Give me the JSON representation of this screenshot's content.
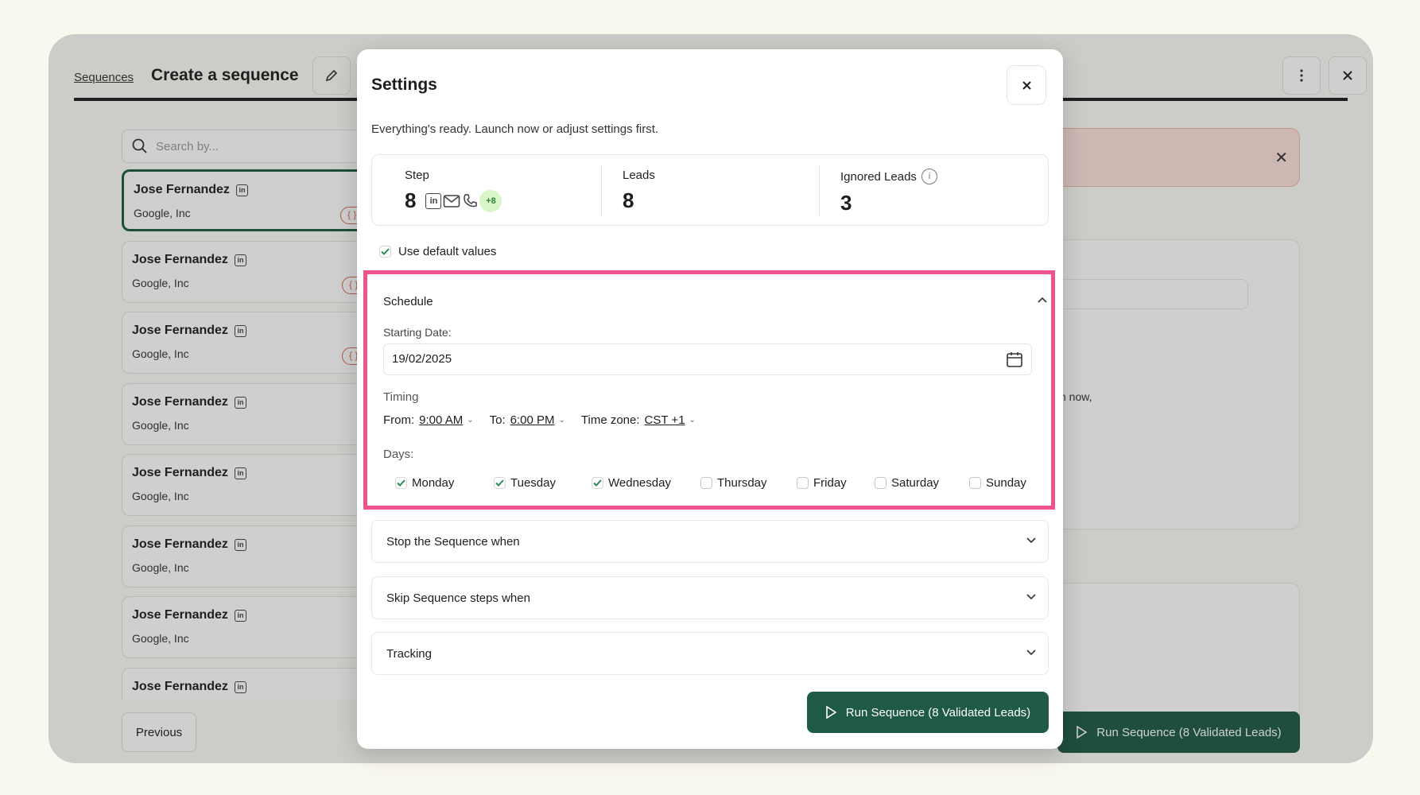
{
  "header": {
    "breadcrumb": "Sequences",
    "title": "Create a sequence"
  },
  "search": {
    "placeholder": "Search by..."
  },
  "leads": [
    {
      "name": "Jose Fernandez",
      "company": "Google, Inc",
      "tag": "{ }"
    },
    {
      "name": "Jose Fernandez",
      "company": "Google, Inc",
      "tag": "{ }"
    },
    {
      "name": "Jose Fernandez",
      "company": "Google, Inc",
      "tag": "{ }"
    },
    {
      "name": "Jose Fernandez",
      "company": "Google, Inc"
    },
    {
      "name": "Jose Fernandez",
      "company": "Google, Inc"
    },
    {
      "name": "Jose Fernandez",
      "company": "Google, Inc"
    },
    {
      "name": "Jose Fernandez",
      "company": "Google, Inc"
    },
    {
      "name": "Jose Fernandez"
    }
  ],
  "previous_label": "Previous",
  "background": {
    "partial_text": "n now,",
    "run_label": "Run Sequence (8 Validated Leads)"
  },
  "modal": {
    "title": "Settings",
    "subtitle": "Everything's ready. Launch now or adjust settings first.",
    "stats": {
      "step_label": "Step",
      "step_value": "8",
      "step_extra": "+8",
      "leads_label": "Leads",
      "leads_value": "8",
      "ignored_label": "Ignored Leads",
      "ignored_value": "3"
    },
    "use_default_label": "Use default values",
    "schedule": {
      "title": "Schedule",
      "starting_date_label": "Starting Date:",
      "starting_date_value": "19/02/2025",
      "timing_label": "Timing",
      "from_label": "From:",
      "from_value": "9:00 AM",
      "to_label": "To:",
      "to_value": "6:00 PM",
      "tz_label": "Time zone:",
      "tz_value": "CST +1",
      "days_label": "Days:",
      "days": [
        {
          "label": "Monday",
          "checked": true
        },
        {
          "label": "Tuesday",
          "checked": true
        },
        {
          "label": "Wednesday",
          "checked": true
        },
        {
          "label": "Thursday",
          "checked": false
        },
        {
          "label": "Friday",
          "checked": false
        },
        {
          "label": "Saturday",
          "checked": false
        },
        {
          "label": "Sunday",
          "checked": false
        }
      ]
    },
    "accordions": [
      {
        "label": "Stop the Sequence when"
      },
      {
        "label": "Skip Sequence steps when"
      },
      {
        "label": "Tracking"
      }
    ],
    "run_label": "Run Sequence (8 Validated Leads)"
  },
  "colors": {
    "accent": "#1e5a45",
    "highlight": "#f0528e",
    "badge_bg": "#d8f6c7"
  }
}
